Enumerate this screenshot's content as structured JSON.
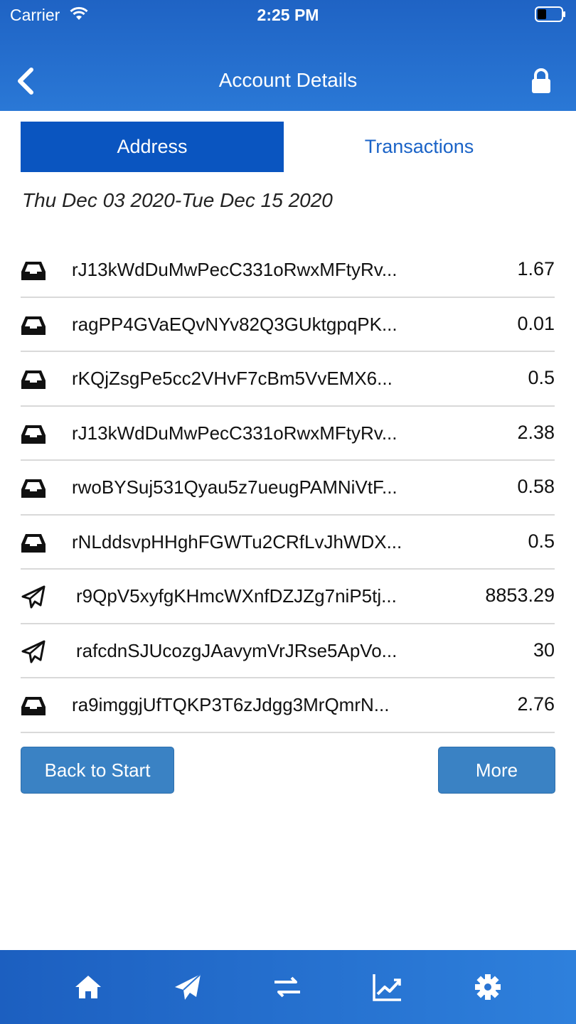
{
  "status_bar": {
    "carrier": "Carrier",
    "time": "2:25 PM"
  },
  "nav": {
    "title": "Account Details",
    "back_icon": "chevron-left-icon",
    "lock_icon": "lock-icon"
  },
  "segment": {
    "address_label": "Address",
    "transactions_label": "Transactions",
    "selected": "Address"
  },
  "date_range": "Thu Dec 03 2020-Tue Dec 15 2020",
  "transactions": [
    {
      "type": "received",
      "icon": "inbox-icon",
      "address": "rJ13kWdDuMwPecC331oRwxMFtyRv...",
      "amount": "1.67"
    },
    {
      "type": "received",
      "icon": "inbox-icon",
      "address": "ragPP4GVaEQvNYv82Q3GUktgpqPK...",
      "amount": "0.01"
    },
    {
      "type": "received",
      "icon": "inbox-icon",
      "address": "rKQjZsgPe5cc2VHvF7cBm5VvEMX6...",
      "amount": "0.5"
    },
    {
      "type": "received",
      "icon": "inbox-icon",
      "address": "rJ13kWdDuMwPecC331oRwxMFtyRv...",
      "amount": "2.38"
    },
    {
      "type": "received",
      "icon": "inbox-icon",
      "address": "rwoBYSuj531Qyau5z7ueugPAMNiVtF...",
      "amount": "0.58"
    },
    {
      "type": "received",
      "icon": "inbox-icon",
      "address": "rNLddsvpHHghFGWTu2CRfLvJhWDX...",
      "amount": "0.5"
    },
    {
      "type": "sent",
      "icon": "paper-plane-icon",
      "address": "r9QpV5xyfgKHmcWXnfDZJZg7niP5tj...",
      "amount": "8853.29"
    },
    {
      "type": "sent",
      "icon": "paper-plane-icon",
      "address": "rafcdnSJUcozgJAavymVrJRse5ApVo...",
      "amount": "30"
    },
    {
      "type": "received",
      "icon": "inbox-icon",
      "address": "ra9imggjUfTQKP3T6zJdgg3MrQmrN...",
      "amount": "2.76"
    }
  ],
  "buttons": {
    "back_to_start": "Back to Start",
    "more": "More"
  },
  "tabbar": {
    "items": [
      "home-icon",
      "paper-plane-icon",
      "exchange-icon",
      "chart-line-icon",
      "gear-icon"
    ]
  },
  "colors": {
    "header": "#1f63c4",
    "segment_active": "#0a55c0",
    "button": "#3a82c4",
    "link": "#1a63c7"
  }
}
